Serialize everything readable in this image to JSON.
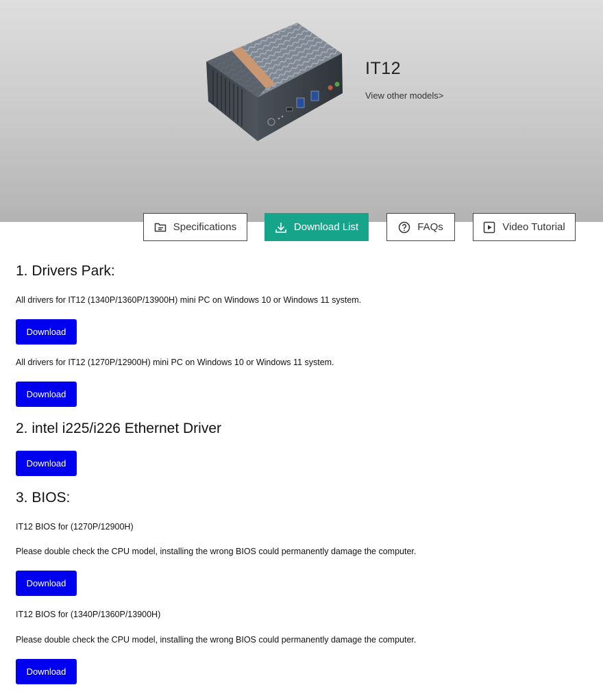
{
  "hero": {
    "model": "IT12",
    "other_models_link": "View other models>"
  },
  "tabs": [
    {
      "label": "Specifications",
      "icon": "folder-icon",
      "active": false
    },
    {
      "label": "Download List",
      "icon": "download-icon",
      "active": true
    },
    {
      "label": "FAQs",
      "icon": "question-circle-icon",
      "active": false
    },
    {
      "label": "Video Tutorial",
      "icon": "play-box-icon",
      "active": false
    }
  ],
  "colors": {
    "accent": "#16a58b",
    "download_button": "#0000ee"
  },
  "sections": {
    "drivers": {
      "title": "1. Drivers Park:",
      "items": [
        {
          "text": "All drivers for IT12 (1340P/1360P/13900H) mini PC on Windows 10 or Windows 11 system.",
          "button": "Download"
        },
        {
          "text": "All drivers for IT12 (1270P/12900H) mini PC on Windows 10 or Windows 11 system.",
          "button": "Download"
        }
      ]
    },
    "ethernet": {
      "title": "2. intel i225/i226 Ethernet Driver",
      "button": "Download"
    },
    "bios": {
      "title": "3. BIOS:",
      "items": [
        {
          "name": "IT12 BIOS for (1270P/12900H)",
          "warning": "Please double check the CPU model, installing the wrong BIOS could permanently damage the computer.",
          "button": "Download"
        },
        {
          "name": "IT12 BIOS for (1340P/1360P/13900H)",
          "warning": "Please double check the CPU model, installing the wrong BIOS could permanently damage the computer.",
          "button": "Download"
        }
      ]
    }
  }
}
